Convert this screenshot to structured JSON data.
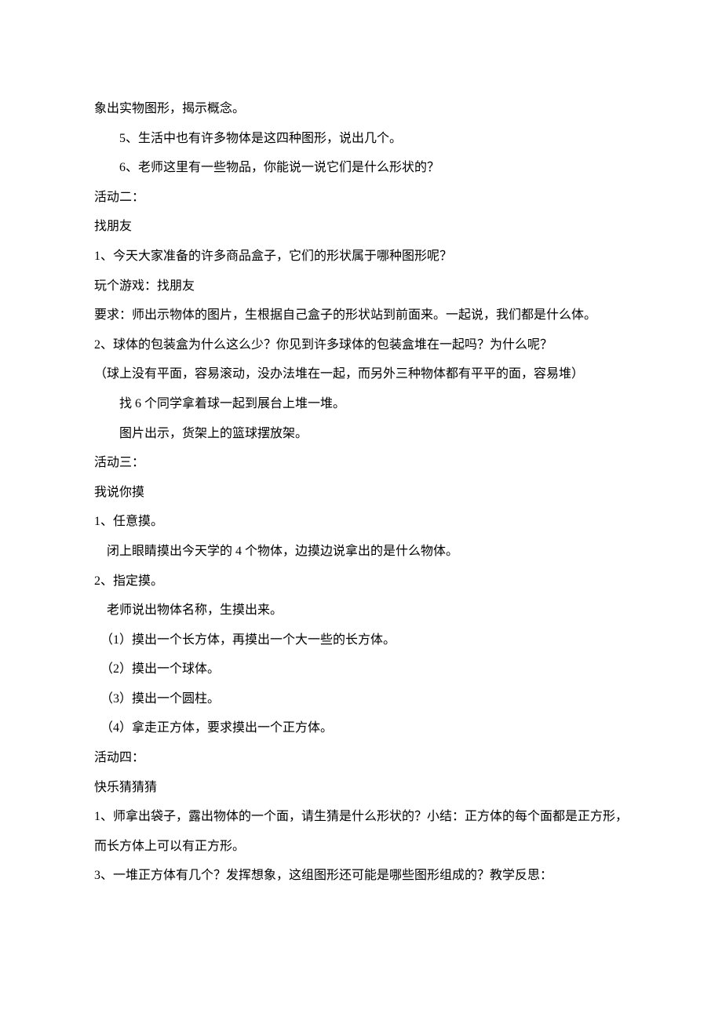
{
  "lines": {
    "l1": "象出实物图形，揭示概念。",
    "l2": "5、生活中也有许多物体是这四种图形，说出几个。",
    "l3": "6、老师这里有一些物品，你能说一说它们是什么形状的？",
    "l4": "活动二：",
    "l5": "找朋友",
    "l6": "1、今天大家准备的许多商品盒子，它们的形状属于哪种图形呢？",
    "l7": "玩个游戏：找朋友",
    "l8": "要求：师出示物体的图片，生根据自己盒子的形状站到前面来。一起说，我们都是什么体。",
    "l9": "2、球体的包装盒为什么这么少？你见到许多球体的包装盒堆在一起吗？为什么呢？",
    "l10": "（球上没有平面，容易滚动，没办法堆在一起，而另外三种物体都有平平的面，容易堆）",
    "l11": "找 6 个同学拿着球一起到展台上堆一堆。",
    "l12": "图片出示，货架上的篮球摆放架。",
    "l13": "活动三：",
    "l14": "我说你摸",
    "l15": "1、任意摸。",
    "l16": "闭上眼睛摸出今天学的 4 个物体，边摸边说拿出的是什么物体。",
    "l17": "2、指定摸。",
    "l18": "老师说出物体名称，生摸出来。",
    "l19": "（1）摸出一个长方体，再摸出一个大一些的长方体。",
    "l20": "（2）摸出一个球体。",
    "l21": "（3）摸出一个圆柱。",
    "l22": "（4）拿走正方体，要求摸出一个正方体。",
    "l23": "活动四：",
    "l24": "快乐猜猜猜",
    "l25": "1、师拿出袋子，露出物体的一个面，请生猜是什么形状的？小结：正方体的每个面都是正方形，而长方体上可以有正方形。",
    "l26": "3、一堆正方体有几个？发挥想象，这组图形还可能是哪些图形组成的？教学反思："
  }
}
